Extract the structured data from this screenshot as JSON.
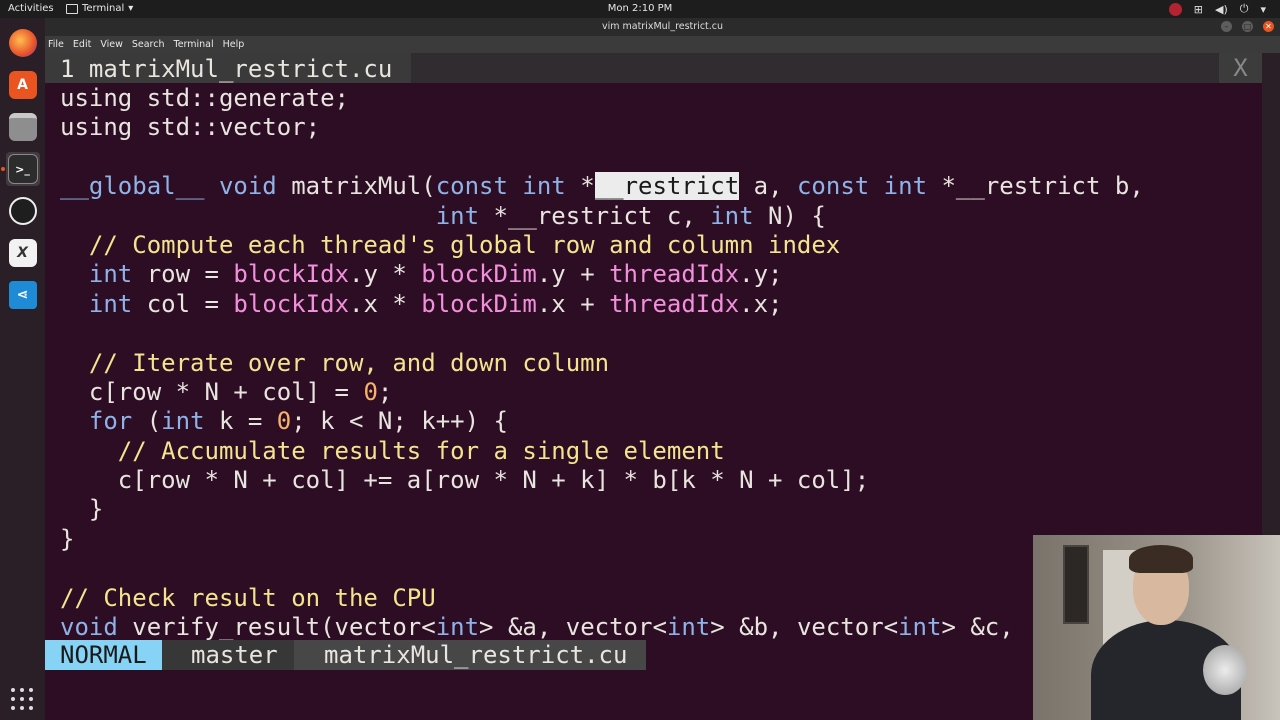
{
  "topbar": {
    "activities": "Activities",
    "app_menu": "Terminal",
    "app_menu_arrow": "▾",
    "clock": "Mon  2:10 PM",
    "tray_icons": [
      "obs-icon",
      "network-icon",
      "volume-icon",
      "power-icon",
      "chevron-down-icon"
    ]
  },
  "dock": {
    "items": [
      "firefox-icon",
      "software-store-icon",
      "files-icon",
      "terminal-icon",
      "obs-studio-icon",
      "calc-icon",
      "vscode-icon"
    ],
    "active": "terminal-icon"
  },
  "window": {
    "title": "vim matrixMul_restrict.cu",
    "menu": [
      "File",
      "Edit",
      "View",
      "Search",
      "Terminal",
      "Help"
    ],
    "minimize_glyph": "–",
    "maximize_glyph": "□",
    "close_glyph": "✕"
  },
  "vim": {
    "tab_label": "1 matrixMul_restrict.cu",
    "tab_close": "X",
    "code": {
      "l1": "using std::generate;",
      "l2": "using std::vector;",
      "l4_a": "__global__",
      "l4_b": " void ",
      "l4_c": "matrixMul(",
      "l4_d": "const",
      "l4_e": " ",
      "l4_f": "int",
      "l4_g": " *",
      "l4_sel": "__restrict",
      "l4_h": " a, ",
      "l4_i": "const",
      "l4_j": " ",
      "l4_k": "int",
      "l4_l": " *__restrict b,",
      "l5_pad": "                          ",
      "l5_a": "int",
      "l5_b": " *__restrict c, ",
      "l5_c": "int",
      "l5_d": " N) {",
      "l6": "  // Compute each thread's global row and column index",
      "l7_a": "  ",
      "l7_b": "int",
      "l7_c": " row = ",
      "l7_d": "blockIdx",
      "l7_e": ".y * ",
      "l7_f": "blockDim",
      "l7_g": ".y + ",
      "l7_h": "threadIdx",
      "l7_i": ".y;",
      "l8_a": "  ",
      "l8_b": "int",
      "l8_c": " col = ",
      "l8_d": "blockIdx",
      "l8_e": ".x * ",
      "l8_f": "blockDim",
      "l8_g": ".x + ",
      "l8_h": "threadIdx",
      "l8_i": ".x;",
      "l10": "  // Iterate over row, and down column",
      "l11_a": "  c[row * N + col] = ",
      "l11_b": "0",
      "l11_c": ";",
      "l12_a": "  ",
      "l12_b": "for",
      "l12_c": " (",
      "l12_d": "int",
      "l12_e": " k = ",
      "l12_f": "0",
      "l12_g": "; k < N; k++) {",
      "l13": "    // Accumulate results for a single element",
      "l14": "    c[row * N + col] += a[row * N + k] * b[k * N + col];",
      "l15": "  }",
      "l16": "}",
      "l18": "// Check result on the CPU",
      "l19_a": "void",
      "l19_b": " verify_result(vector<",
      "l19_c": "int",
      "l19_d": "> &a, vector<",
      "l19_e": "int",
      "l19_f": "> &b, vector<",
      "l19_g": "int",
      "l19_h": "> &c,"
    },
    "status": {
      "mode": "NORMAL",
      "branch": "master",
      "file": "matrixMul_restrict.cu"
    }
  },
  "colors": {
    "terminal_bg": "#2c0d24",
    "keyword": "#8fb3e8",
    "function": "#f290dc",
    "comment": "#f3e48f",
    "number": "#f7b26b",
    "mode_bg": "#87d3f5"
  }
}
